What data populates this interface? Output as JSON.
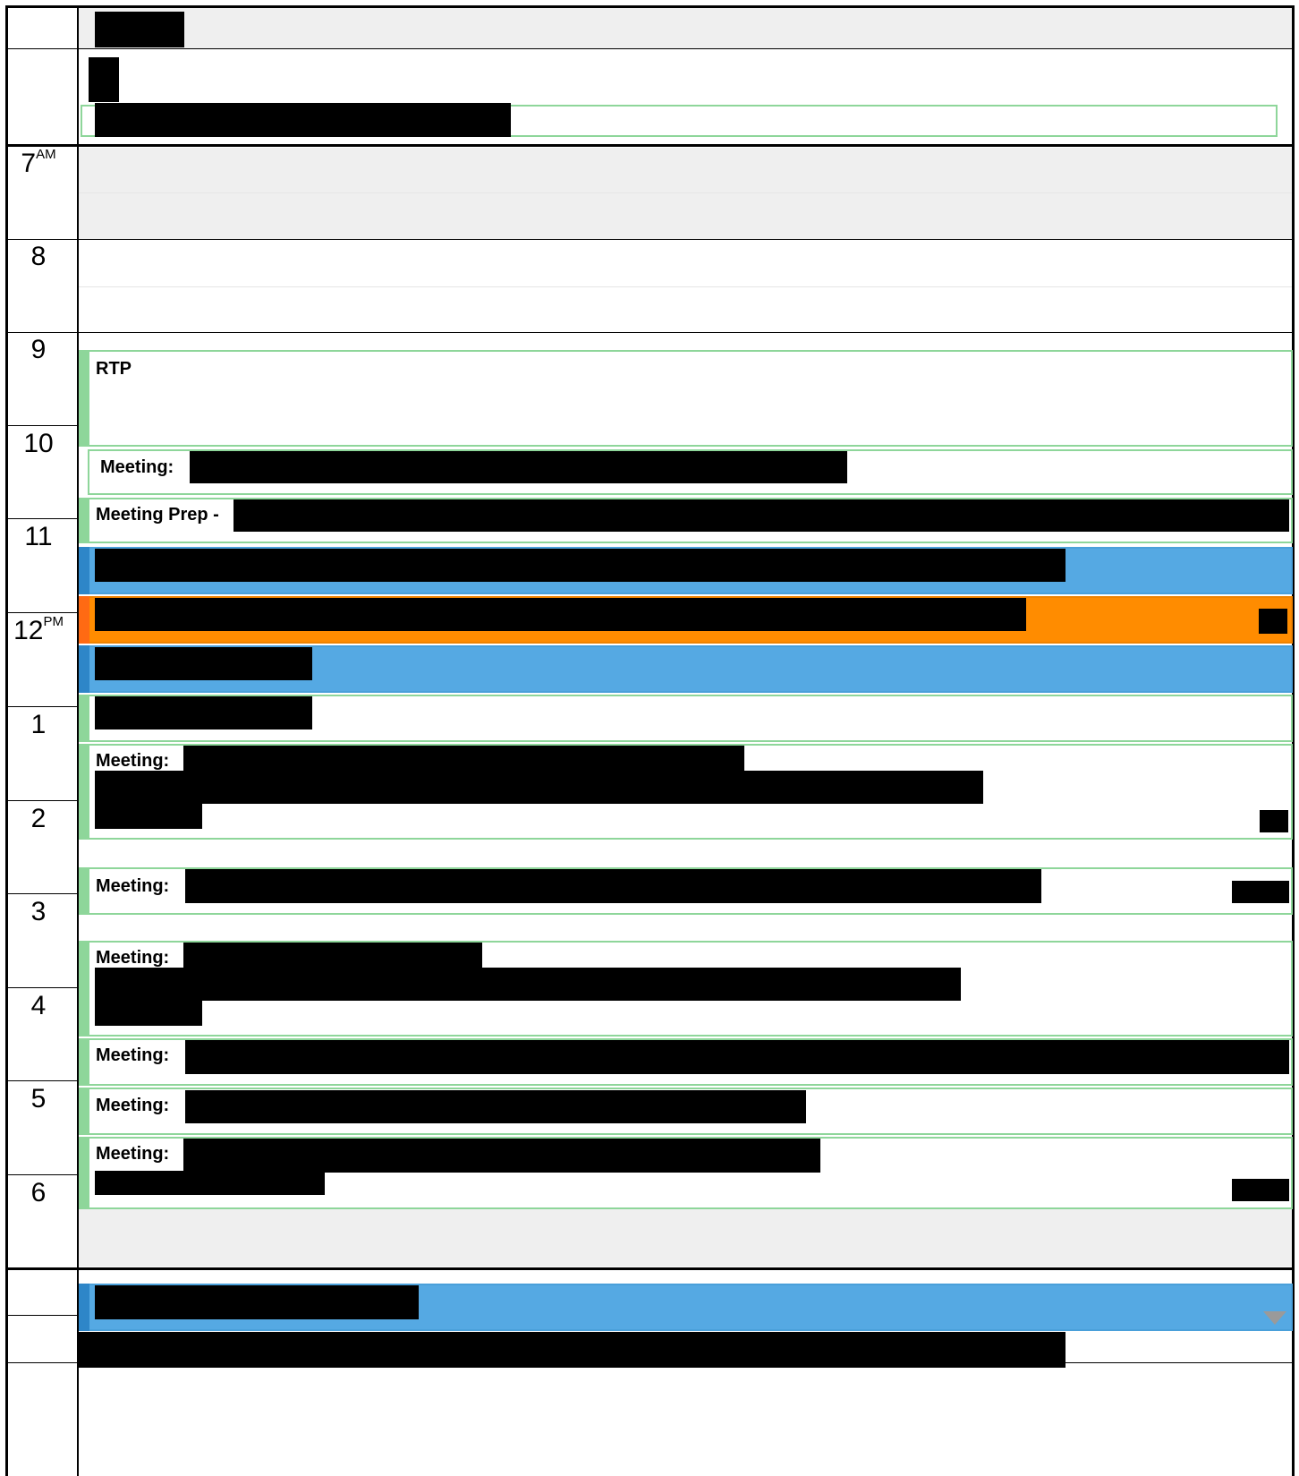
{
  "calendar": {
    "hours": [
      {
        "label": "7",
        "suffix": "AM"
      },
      {
        "label": "8",
        "suffix": ""
      },
      {
        "label": "9",
        "suffix": ""
      },
      {
        "label": "10",
        "suffix": ""
      },
      {
        "label": "11",
        "suffix": ""
      },
      {
        "label": "12",
        "suffix": "PM"
      },
      {
        "label": "1",
        "suffix": ""
      },
      {
        "label": "2",
        "suffix": ""
      },
      {
        "label": "3",
        "suffix": ""
      },
      {
        "label": "4",
        "suffix": ""
      },
      {
        "label": "5",
        "suffix": ""
      },
      {
        "label": "6",
        "suffix": ""
      }
    ],
    "events": {
      "rtp": "RTP",
      "meeting_10": "Meeting:",
      "meeting_prep": "Meeting Prep -",
      "meeting_1": "Meeting:",
      "meeting_2": "Meeting:",
      "meeting_3": "Meeting:",
      "meeting_4a": "Meeting:",
      "meeting_4b": "Meeting:",
      "meeting_5": "Meeting:"
    },
    "colors": {
      "event_border": "#8ed69a",
      "blue_event": "#55a9e3",
      "orange_event": "#ff8c00",
      "working_hours_off": "#efefef"
    }
  }
}
